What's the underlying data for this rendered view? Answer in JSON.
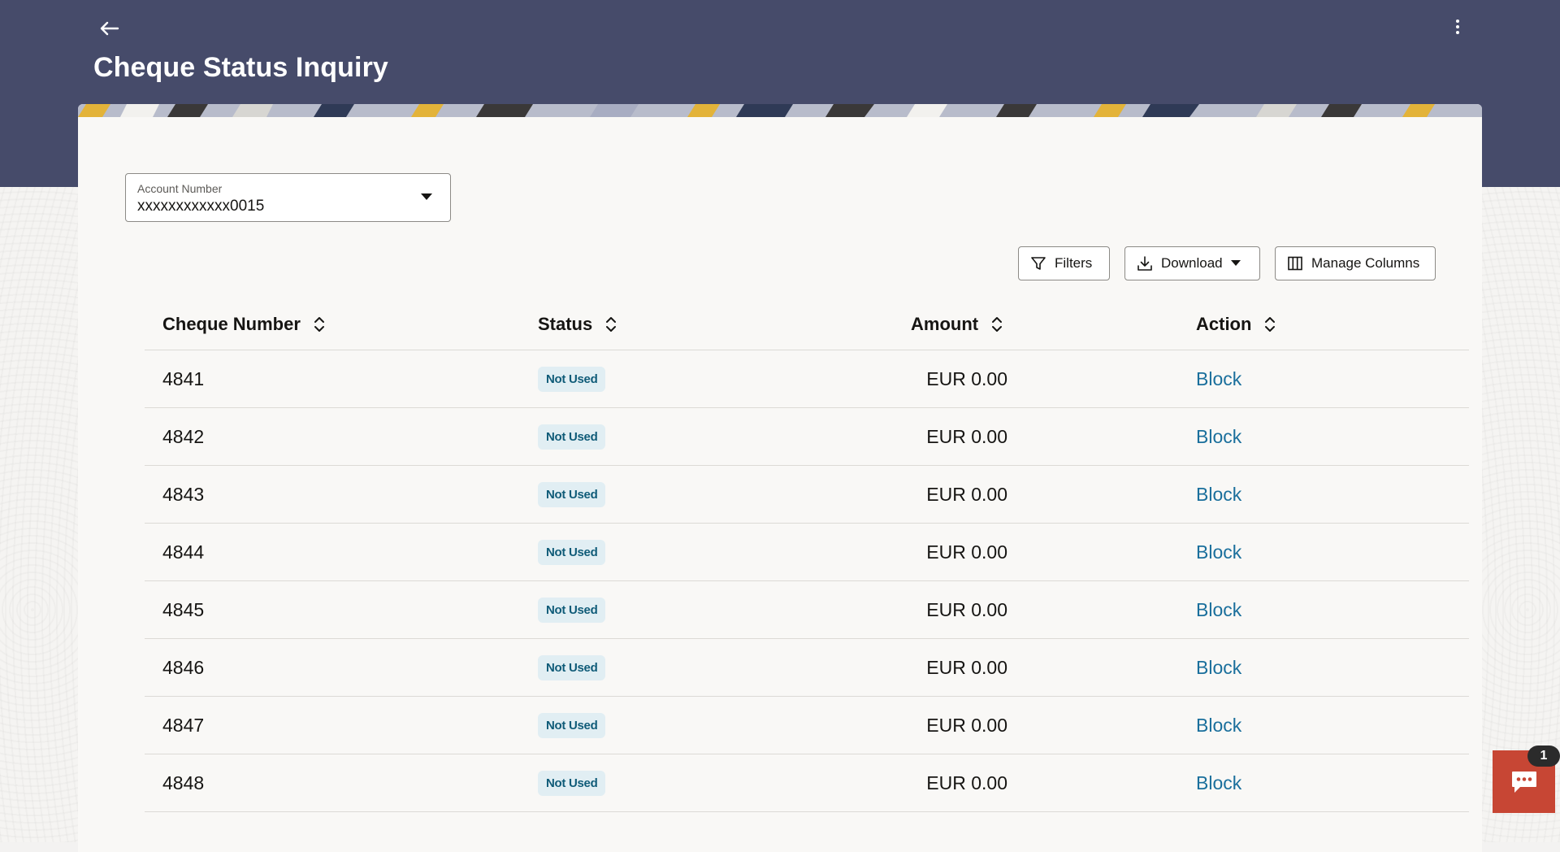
{
  "page": {
    "title": "Cheque Status Inquiry"
  },
  "account": {
    "label": "Account Number",
    "value": "xxxxxxxxxxxx0015"
  },
  "toolbar": {
    "filters_label": "Filters",
    "download_label": "Download",
    "manage_columns_label": "Manage Columns"
  },
  "table": {
    "headers": [
      "Cheque Number",
      "Status",
      "Amount",
      "Action"
    ],
    "rows": [
      {
        "cheque_number": "4841",
        "status": "Not Used",
        "amount": "EUR 0.00",
        "action": "Block"
      },
      {
        "cheque_number": "4842",
        "status": "Not Used",
        "amount": "EUR 0.00",
        "action": "Block"
      },
      {
        "cheque_number": "4843",
        "status": "Not Used",
        "amount": "EUR 0.00",
        "action": "Block"
      },
      {
        "cheque_number": "4844",
        "status": "Not Used",
        "amount": "EUR 0.00",
        "action": "Block"
      },
      {
        "cheque_number": "4845",
        "status": "Not Used",
        "amount": "EUR 0.00",
        "action": "Block"
      },
      {
        "cheque_number": "4846",
        "status": "Not Used",
        "amount": "EUR 0.00",
        "action": "Block"
      },
      {
        "cheque_number": "4847",
        "status": "Not Used",
        "amount": "EUR 0.00",
        "action": "Block"
      },
      {
        "cheque_number": "4848",
        "status": "Not Used",
        "amount": "EUR 0.00",
        "action": "Block"
      }
    ]
  },
  "chat": {
    "badge_count": "1"
  },
  "icons": {
    "back": "arrow-left-icon",
    "menu": "kebab-menu-icon",
    "dropdown": "caret-down-icon",
    "filter": "filter-icon",
    "download": "download-icon",
    "columns": "columns-icon",
    "sort": "sort-icon",
    "chat": "chat-icon"
  },
  "colors": {
    "header_band": "#464b6a",
    "status_badge_bg": "#e1eef3",
    "status_badge_text": "#0f5b78",
    "link": "#1a6f9c",
    "chat_button": "#c74634"
  }
}
